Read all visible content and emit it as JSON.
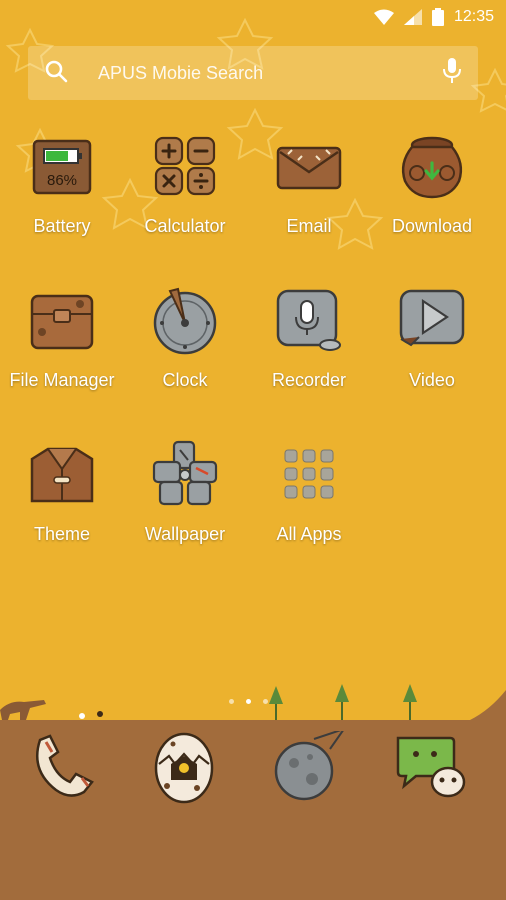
{
  "status_bar": {
    "time": "12:35",
    "icons": [
      "wifi-icon",
      "cell-signal-icon",
      "battery-icon"
    ]
  },
  "search": {
    "placeholder": "APUS Mobie Search",
    "icons": [
      "search-icon",
      "microphone-icon"
    ]
  },
  "apps": [
    {
      "label": "Battery",
      "icon": "battery-app-icon",
      "badge": "86%"
    },
    {
      "label": "Calculator",
      "icon": "calculator-icon"
    },
    {
      "label": "Email",
      "icon": "email-icon"
    },
    {
      "label": "Download",
      "icon": "download-icon"
    },
    {
      "label": "File Manager",
      "icon": "file-manager-icon"
    },
    {
      "label": "Clock",
      "icon": "clock-icon"
    },
    {
      "label": "Recorder",
      "icon": "recorder-icon"
    },
    {
      "label": "Video",
      "icon": "video-icon"
    },
    {
      "label": "Theme",
      "icon": "theme-icon"
    },
    {
      "label": "Wallpaper",
      "icon": "wallpaper-icon"
    },
    {
      "label": "All Apps",
      "icon": "all-apps-icon"
    }
  ],
  "page_indicator": {
    "count": 3,
    "active": 2
  },
  "dock": [
    {
      "icon": "phone-icon"
    },
    {
      "icon": "camera-egg-icon"
    },
    {
      "icon": "browser-meteor-icon"
    },
    {
      "icon": "messaging-icon"
    }
  ],
  "colors": {
    "background": "#ecb22e",
    "ground": "#a26c3c",
    "text": "#ffffff"
  }
}
